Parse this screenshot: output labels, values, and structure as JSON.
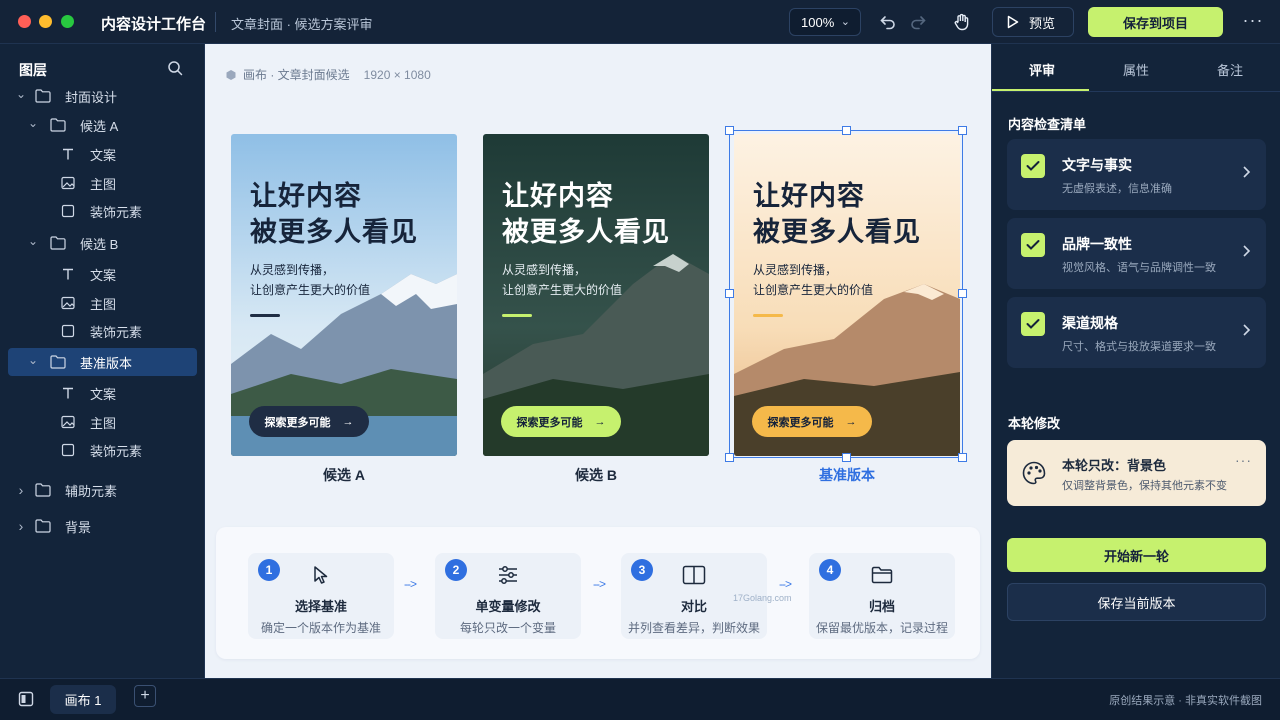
{
  "titlebar": {
    "app_title": "内容设计工作台",
    "doc_title": "文章封面 · 候选方案评审",
    "zoom": "100%",
    "preview_label": "预览",
    "save_project_label": "保存到项目",
    "more_label": "···"
  },
  "layers": {
    "title": "图层",
    "items": [
      {
        "label": "封面设计"
      },
      {
        "label": "候选 A"
      },
      {
        "label": "文案"
      },
      {
        "label": "主图"
      },
      {
        "label": "装饰元素"
      },
      {
        "label": "候选 B"
      },
      {
        "label": "文案"
      },
      {
        "label": "主图"
      },
      {
        "label": "装饰元素"
      },
      {
        "label": "基准版本"
      },
      {
        "label": "文案"
      },
      {
        "label": "主图"
      },
      {
        "label": "装饰元素"
      },
      {
        "label": "辅助元素"
      },
      {
        "label": "背景"
      }
    ]
  },
  "canvas": {
    "header": "画布 · 文章封面候选",
    "dimensions": "1920 × 1080",
    "cards": [
      {
        "headline1": "让好内容",
        "headline2": "被更多人看见",
        "sub1": "从灵感到传播，",
        "sub2": "让创意产生更大的价值",
        "button": "探索更多可能",
        "caption": "候选 A",
        "accent": "#1f2d44"
      },
      {
        "headline1": "让好内容",
        "headline2": "被更多人看见",
        "sub1": "从灵感到传播，",
        "sub2": "让创意产生更大的价值",
        "button": "探索更多可能",
        "caption": "候选 B",
        "accent": "#c6f16e"
      },
      {
        "headline1": "让好内容",
        "headline2": "被更多人看见",
        "sub1": "从灵感到传播，",
        "sub2": "让创意产生更大的价值",
        "button": "探索更多可能",
        "caption": "基准版本",
        "accent": "#f5b94a"
      }
    ],
    "steps": [
      {
        "num": "1",
        "title": "选择基准",
        "desc": "确定一个版本作为基准"
      },
      {
        "num": "2",
        "title": "单变量修改",
        "desc": "每轮只改一个变量"
      },
      {
        "num": "3",
        "title": "对比",
        "desc": "并列查看差异，判断效果"
      },
      {
        "num": "4",
        "title": "归档",
        "desc": "保留最优版本，记录过程"
      }
    ],
    "arrow": "-->",
    "watermark": "17Golang.com"
  },
  "right": {
    "tabs": [
      {
        "label": "评审"
      },
      {
        "label": "属性"
      },
      {
        "label": "备注"
      }
    ],
    "checklist_title": "内容检查清单",
    "checks": [
      {
        "title": "文字与事实",
        "sub": "无虚假表述，信息准确"
      },
      {
        "title": "品牌一致性",
        "sub": "视觉风格、语气与品牌调性一致"
      },
      {
        "title": "渠道规格",
        "sub": "尺寸、格式与投放渠道要求一致"
      }
    ],
    "edit_title": "本轮修改",
    "edit_card": {
      "title": "本轮只改：背景色",
      "sub": "仅调整背景色，保持其他元素不变",
      "more": "···"
    },
    "start_label": "开始新一轮",
    "save_version_label": "保存当前版本"
  },
  "bottom": {
    "tab_label": "画布 1",
    "add_label": "+",
    "note": "原创结果示意 · 非真实软件截图"
  },
  "colors": {
    "accent_green": "#c6f16e",
    "selection_blue": "#3e7be6",
    "panel_bg": "#13243a"
  }
}
